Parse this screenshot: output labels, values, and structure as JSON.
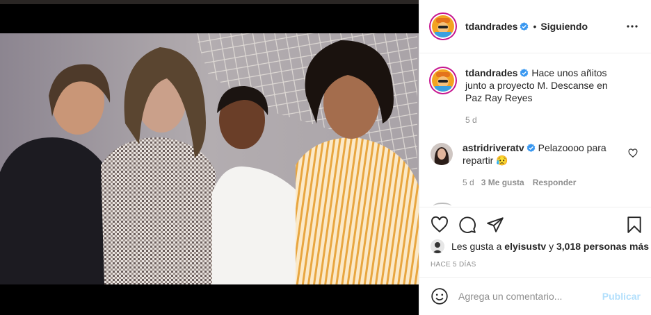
{
  "post": {
    "author": "tdandrades",
    "follow_state": "Siguiendo",
    "caption": "Hace unos añitos junto a proyecto M. Descanse en Paz Ray Reyes",
    "caption_age": "5 d",
    "time_ago": "Hace 5 días",
    "verified": true
  },
  "comments": [
    {
      "author": "astridriveratv",
      "text": "Pelazoooo para repartir 😥",
      "age": "5 d",
      "likes": "3 Me gusta",
      "reply_label": "Responder",
      "verified": true
    }
  ],
  "likes": {
    "prefix": "Les gusta a",
    "user": "elyisustv",
    "connector": "y",
    "others": "3,018 personas más"
  },
  "comment_box": {
    "placeholder": "Agrega un comentario...",
    "publish_label": "Publicar"
  },
  "icons": {
    "more": "more-options-icon",
    "like": "heart-icon",
    "comment": "comment-bubble-icon",
    "share": "paper-plane-icon",
    "save": "bookmark-icon",
    "emoji": "smiley-icon",
    "verified": "verified-badge-icon"
  },
  "colors": {
    "verified_blue": "#3897f0",
    "story_ring": "#c5168f",
    "publish_disabled": "#b2dffc"
  }
}
